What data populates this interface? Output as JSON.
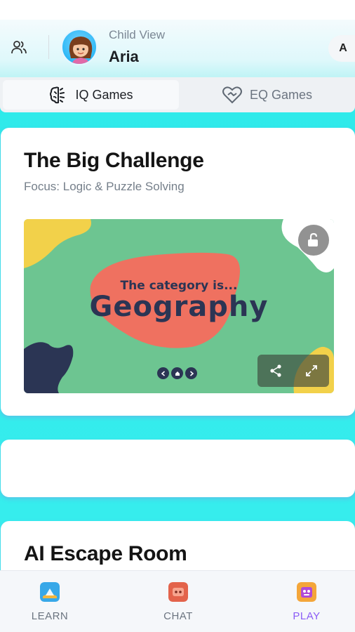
{
  "header": {
    "child_view_label": "Child View",
    "child_name": "Aria",
    "account_initial": "A"
  },
  "tabs": [
    {
      "label": "IQ Games",
      "icon": "brain-icon",
      "active": true
    },
    {
      "label": "EQ Games",
      "icon": "heart-icon",
      "active": false
    }
  ],
  "featured_game": {
    "title": "The Big Challenge",
    "focus": "Focus: Logic & Puzzle Solving",
    "preview": {
      "line1": "The category is...",
      "line2": "Geography"
    }
  },
  "next_card": {
    "title": "AI Escape Room"
  },
  "bottom_nav": [
    {
      "label": "LEARN",
      "icon": "learn-icon",
      "active": false
    },
    {
      "label": "CHAT",
      "icon": "chat-icon",
      "active": false
    },
    {
      "label": "PLAY",
      "icon": "play-icon",
      "active": true
    }
  ],
  "colors": {
    "accent": "#8b5cf6",
    "background": "#38eeee",
    "game_bg": "#6dc591",
    "game_blob": "#ef7160"
  }
}
